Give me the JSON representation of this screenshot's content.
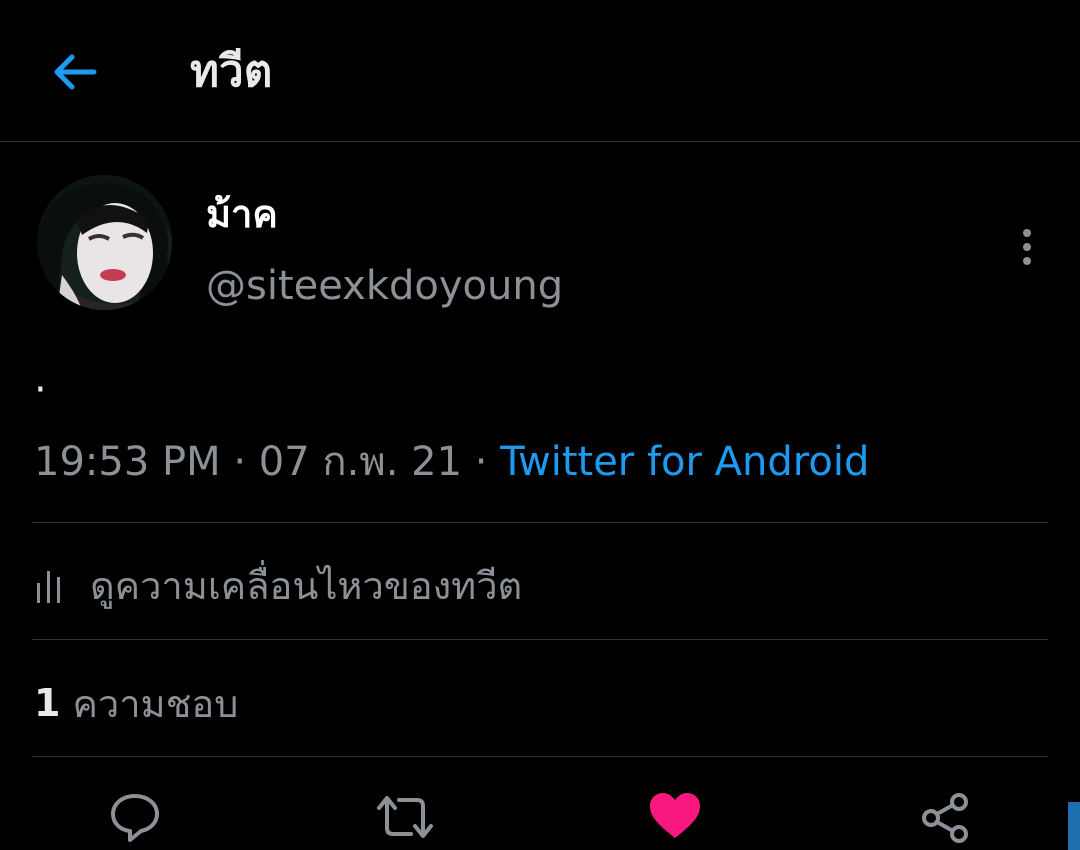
{
  "colors": {
    "background": "#000000",
    "accent": "#1d9bf0",
    "secondary_text": "#8b9196",
    "divider": "#2f3336",
    "like": "#f91880"
  },
  "header": {
    "back_icon": "arrow-left-icon",
    "title": "ทวีต"
  },
  "author": {
    "display_name": "ม้าค",
    "handle": "@siteexkdoyoung",
    "avatar": "profile-photo"
  },
  "tweet": {
    "text": "·",
    "time": "19:53 PM",
    "separator": "·",
    "date": "07 ก.พ. 21",
    "source": "Twitter for Android"
  },
  "activity": {
    "icon": "bar-chart-icon",
    "label": "ดูความเคลื่อนไหวของทวีต"
  },
  "stats": {
    "likes_count": "1",
    "likes_label": "ความชอบ"
  },
  "actions": [
    {
      "name": "reply",
      "icon": "speech-bubble-icon"
    },
    {
      "name": "retweet",
      "icon": "retweet-arrows-icon"
    },
    {
      "name": "like",
      "icon": "heart-icon",
      "active": true
    },
    {
      "name": "share",
      "icon": "share-icon"
    }
  ]
}
